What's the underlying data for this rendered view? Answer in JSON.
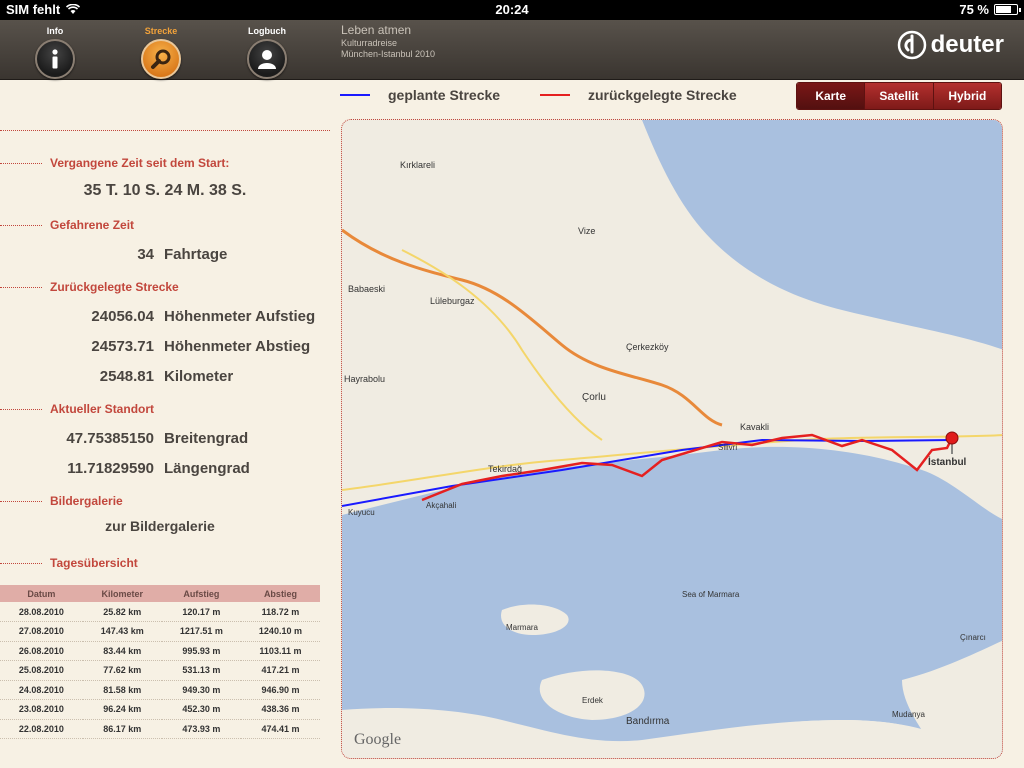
{
  "statusbar": {
    "carrier": "SIM fehlt",
    "time": "20:24",
    "battery": "75 %",
    "battery_level": 0.75
  },
  "nav": [
    {
      "label": "Info",
      "icon": "info-icon",
      "active": false
    },
    {
      "label": "Strecke",
      "icon": "search-icon",
      "active": true
    },
    {
      "label": "Logbuch",
      "icon": "user-icon",
      "active": false
    }
  ],
  "header": {
    "title": "Leben atmen",
    "subtitle": "Kulturradreise",
    "route": "München-Istanbul 2010"
  },
  "logo": {
    "text": "deuter",
    "icon": "deuter-logo-icon"
  },
  "stats": {
    "elapsed": {
      "label": "Vergangene Zeit seit dem Start:",
      "value": "35 T. 10 S. 24 M. 38 S."
    },
    "riding": {
      "label": "Gefahrene Zeit",
      "value": "34",
      "unit": "Fahrtage"
    },
    "distance": {
      "label": "Zurückgelegte Strecke",
      "rows": [
        {
          "value": "24056.04",
          "unit": "Höhenmeter Aufstieg"
        },
        {
          "value": "24573.71",
          "unit": "Höhenmeter Abstieg"
        },
        {
          "value": "2548.81",
          "unit": "Kilometer"
        }
      ]
    },
    "location": {
      "label": "Aktueller Standort",
      "rows": [
        {
          "value": "47.75385150",
          "unit": "Breitengrad"
        },
        {
          "value": "11.71829590",
          "unit": "Längengrad"
        }
      ]
    },
    "gallery": {
      "label": "Bildergalerie",
      "link": "zur Bildergalerie"
    },
    "daily": {
      "label": "Tagesübersicht"
    }
  },
  "table": {
    "headers": [
      "Datum",
      "Kilometer",
      "Aufstieg",
      "Abstieg"
    ],
    "rows": [
      [
        "28.08.2010",
        "25.82  km",
        "120.17  m",
        "118.72  m"
      ],
      [
        "27.08.2010",
        "147.43  km",
        "1217.51  m",
        "1240.10  m"
      ],
      [
        "26.08.2010",
        "83.44  km",
        "995.93  m",
        "1103.11  m"
      ],
      [
        "25.08.2010",
        "77.62  km",
        "531.13  m",
        "417.21  m"
      ],
      [
        "24.08.2010",
        "81.58  km",
        "949.30  m",
        "946.90  m"
      ],
      [
        "23.08.2010",
        "96.24  km",
        "452.30  m",
        "438.36  m"
      ],
      [
        "22.08.2010",
        "86.17  km",
        "473.93  m",
        "474.41  m"
      ]
    ]
  },
  "legend": {
    "planned": {
      "label": "geplante Strecke",
      "color": "#1a1aff"
    },
    "travelled": {
      "label": "zurückgelegte Strecke",
      "color": "#e52020"
    }
  },
  "map_types": [
    {
      "label": "Karte",
      "selected": true
    },
    {
      "label": "Satellit",
      "selected": false
    },
    {
      "label": "Hybrid",
      "selected": false
    }
  ],
  "map": {
    "attribution": "Google",
    "places": [
      "Kırklareli",
      "Babaeski",
      "Lüleburgaz",
      "Vize",
      "Çorlu",
      "Tekirdağ",
      "Kavakli",
      "Silivri",
      "İstanbul",
      "Sea of Marmara",
      "Marmara",
      "Erdek",
      "Bandırma",
      "Hayrabolu",
      "Çerkezköy",
      "Kuyucu",
      "Akçahali",
      "Mudanya",
      "Çınarcı"
    ]
  }
}
